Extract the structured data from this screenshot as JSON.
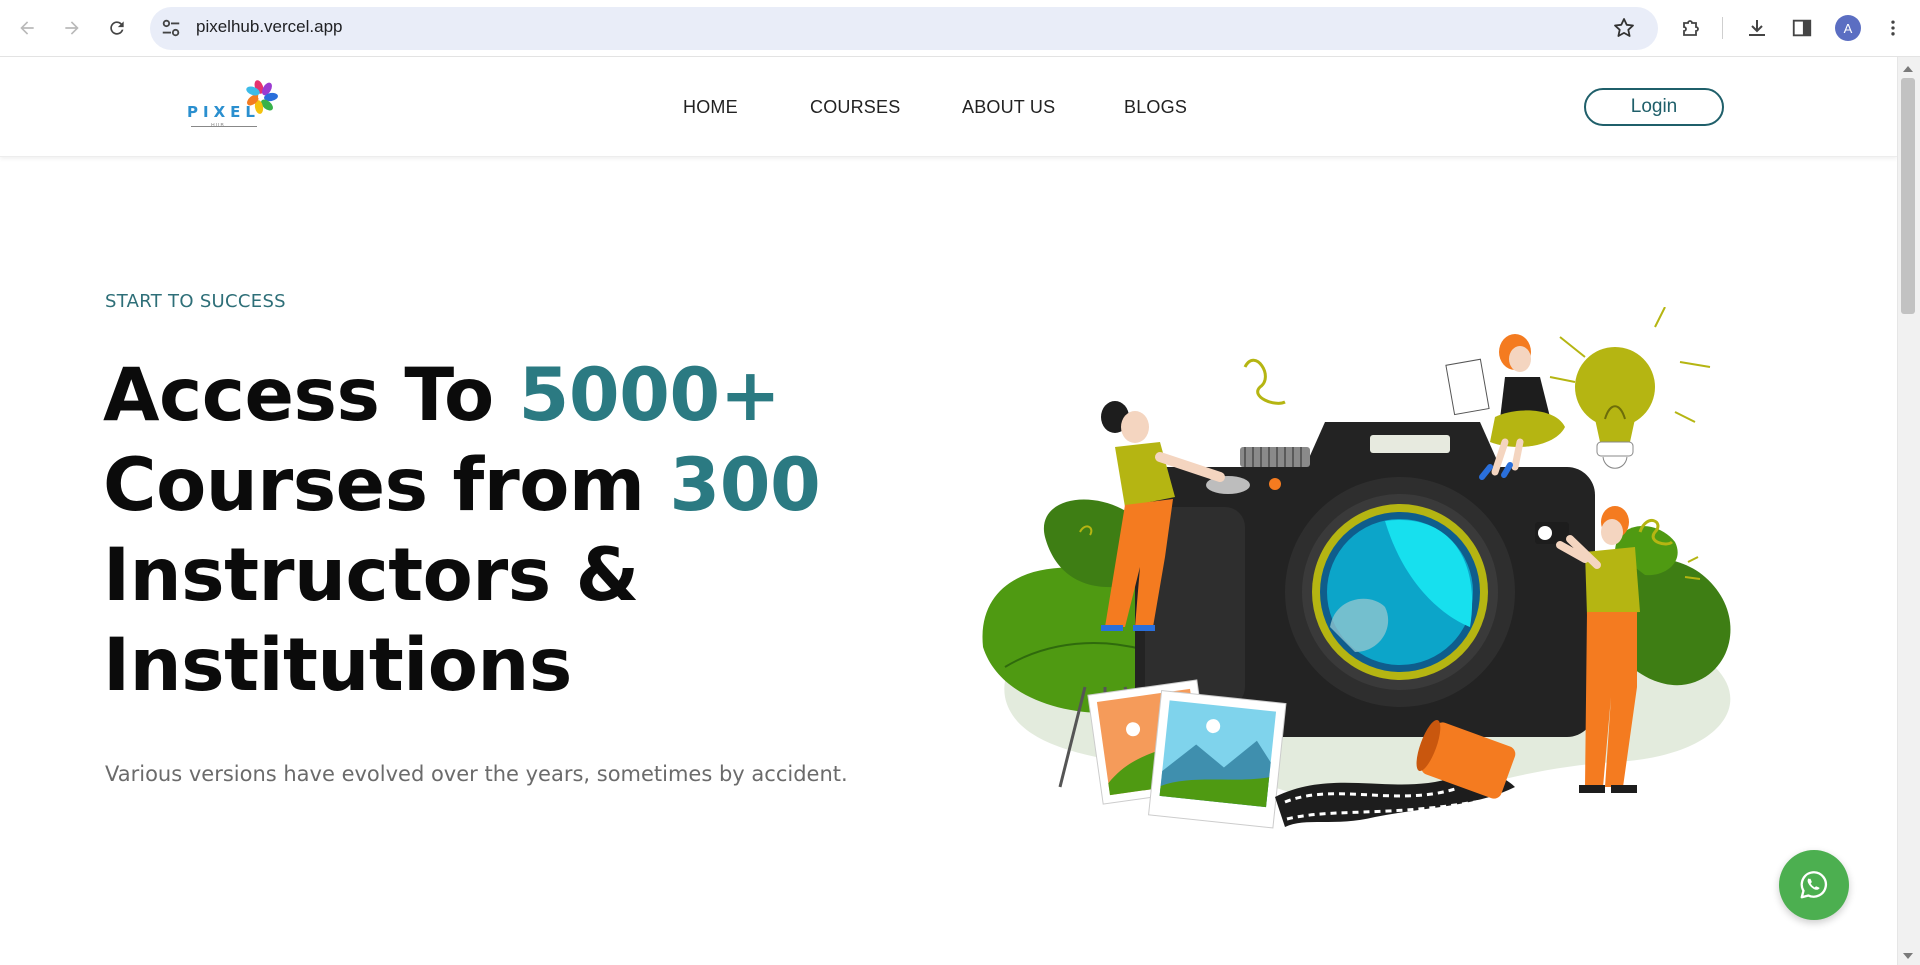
{
  "browser": {
    "url": "pixelhub.vercel.app",
    "profile_initial": "A",
    "icons": {
      "back": "arrow-left-icon",
      "forward": "arrow-right-icon",
      "reload": "reload-icon",
      "site_info": "tune-icon",
      "bookmark": "star-icon",
      "extensions": "puzzle-icon",
      "downloads": "download-icon",
      "side_panel": "side-panel-icon",
      "menu": "more-vert-icon"
    }
  },
  "site": {
    "logo_text": "PIXEL",
    "logo_sub": "HUB",
    "nav": [
      {
        "label": "HOME"
      },
      {
        "label": "COURSES"
      },
      {
        "label": "ABOUT US"
      },
      {
        "label": "BLOGS"
      }
    ],
    "login_label": "Login"
  },
  "hero": {
    "eyebrow": "START TO SUCCESS",
    "line1_a": "Access To ",
    "line1_b": "5000+",
    "line2_a": "Courses from ",
    "line2_b": "300",
    "line3": "Instructors &",
    "line4": "Institutions",
    "subline": "Various versions have evolved over the years, sometimes by accident."
  },
  "colors": {
    "accent": "#2b7a82",
    "login_border": "#1f5f6a",
    "whatsapp": "#4caf50"
  },
  "whatsapp": {
    "icon": "whatsapp-icon"
  }
}
